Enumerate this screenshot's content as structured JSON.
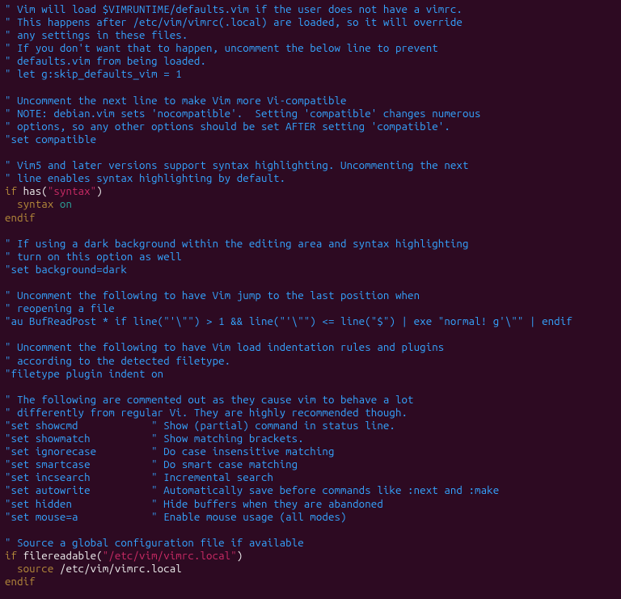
{
  "lines": [
    [
      [
        "c",
        "\" Vim will load $VIMRUNTIME/defaults.vim if the user does not have a vimrc."
      ]
    ],
    [
      [
        "c",
        "\" This happens after /etc/vim/vimrc(.local) are loaded, so it will override"
      ]
    ],
    [
      [
        "c",
        "\" any settings in these files."
      ]
    ],
    [
      [
        "c",
        "\" If you don't want that to happen, uncomment the below line to prevent"
      ]
    ],
    [
      [
        "c",
        "\" defaults.vim from being loaded."
      ]
    ],
    [
      [
        "c",
        "\" let g:skip_defaults_vim = 1"
      ]
    ],
    [],
    [
      [
        "c",
        "\" Uncomment the next line to make Vim more Vi-compatible"
      ]
    ],
    [
      [
        "c",
        "\" NOTE: debian.vim sets 'nocompatible'.  Setting 'compatible' changes numerous"
      ]
    ],
    [
      [
        "c",
        "\" options, so any other options should be set AFTER setting 'compatible'."
      ]
    ],
    [
      [
        "c",
        "\"set compatible"
      ]
    ],
    [],
    [
      [
        "c",
        "\" Vim5 and later versions support syntax highlighting. Uncommenting the next"
      ]
    ],
    [
      [
        "c",
        "\" line enables syntax highlighting by default."
      ]
    ],
    [
      [
        "stm",
        "if"
      ],
      [
        "txt",
        " has("
      ],
      [
        "str",
        "\"syntax\""
      ],
      [
        "txt",
        ")"
      ]
    ],
    [
      [
        "txt",
        "  "
      ],
      [
        "stm",
        "syntax"
      ],
      [
        "fn",
        " on"
      ]
    ],
    [
      [
        "stm",
        "endif"
      ]
    ],
    [],
    [
      [
        "c",
        "\" If using a dark background within the editing area and syntax highlighting"
      ]
    ],
    [
      [
        "c",
        "\" turn on this option as well"
      ]
    ],
    [
      [
        "c",
        "\"set background=dark"
      ]
    ],
    [],
    [
      [
        "c",
        "\" Uncomment the following to have Vim jump to the last position when"
      ]
    ],
    [
      [
        "c",
        "\" reopening a file"
      ]
    ],
    [
      [
        "c",
        "\"au BufReadPost * if line(\"'\\\"\") > 1 && line(\"'\\\"\") <= line(\"$\") | exe \"normal! g'\\\"\" | endif"
      ]
    ],
    [],
    [
      [
        "c",
        "\" Uncomment the following to have Vim load indentation rules and plugins"
      ]
    ],
    [
      [
        "c",
        "\" according to the detected filetype."
      ]
    ],
    [
      [
        "c",
        "\"filetype plugin indent on"
      ]
    ],
    [],
    [
      [
        "c",
        "\" The following are commented out as they cause vim to behave a lot"
      ]
    ],
    [
      [
        "c",
        "\" differently from regular Vi. They are highly recommended though."
      ]
    ],
    [
      [
        "c",
        "\"set showcmd            \" Show (partial) command in status line."
      ]
    ],
    [
      [
        "c",
        "\"set showmatch          \" Show matching brackets."
      ]
    ],
    [
      [
        "c",
        "\"set ignorecase         \" Do case insensitive matching"
      ]
    ],
    [
      [
        "c",
        "\"set smartcase          \" Do smart case matching"
      ]
    ],
    [
      [
        "c",
        "\"set incsearch          \" Incremental search"
      ]
    ],
    [
      [
        "c",
        "\"set autowrite          \" Automatically save before commands like :next and :make"
      ]
    ],
    [
      [
        "c",
        "\"set hidden             \" Hide buffers when they are abandoned"
      ]
    ],
    [
      [
        "c",
        "\"set mouse=a            \" Enable mouse usage (all modes)"
      ]
    ],
    [],
    [
      [
        "c",
        "\" Source a global configuration file if available"
      ]
    ],
    [
      [
        "stm",
        "if"
      ],
      [
        "txt",
        " filereadable("
      ],
      [
        "str",
        "\"/etc/vim/vimrc.local\""
      ],
      [
        "txt",
        ")"
      ]
    ],
    [
      [
        "txt",
        "  "
      ],
      [
        "stm",
        "source"
      ],
      [
        "txt",
        " /etc/vim/vimrc.local"
      ]
    ],
    [
      [
        "stm",
        "endif"
      ]
    ]
  ]
}
